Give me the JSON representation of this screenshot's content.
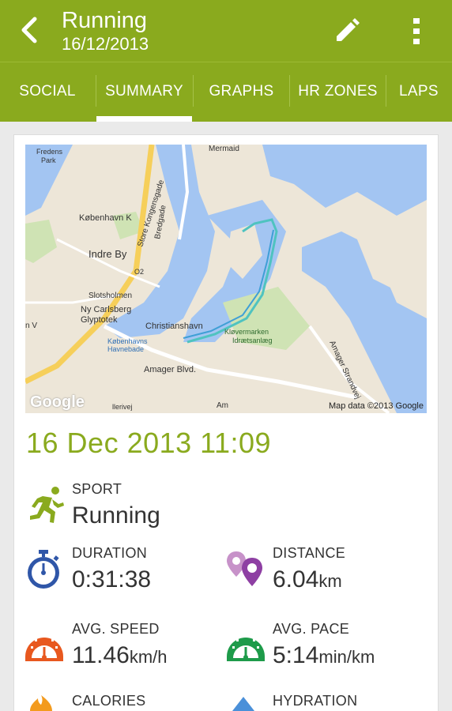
{
  "header": {
    "title": "Running",
    "subtitle": "16/12/2013"
  },
  "tabs": [
    {
      "label": "SOCIAL"
    },
    {
      "label": "SUMMARY"
    },
    {
      "label": "GRAPHS"
    },
    {
      "label": "HR ZONES"
    },
    {
      "label": "LAPS"
    }
  ],
  "active_tab": "SUMMARY",
  "map": {
    "provider": "Google",
    "credit": "Map data ©2013 Google",
    "labels": [
      "Mermaid",
      "Fredens Park",
      "København K",
      "Store Kongensgade",
      "Bredgade",
      "Indre By",
      "O2",
      "Slotsholmen",
      "Ny Carlsberg Glyptotek",
      "Christianshavn",
      "Københavns Havnebade",
      "Kløvermarken Idrætsanlæg",
      "Amager Blvd.",
      "Amager Strandvej",
      "llerivej",
      "n V",
      "Am"
    ]
  },
  "workout": {
    "datetime": "16 Dec 2013 11:09",
    "sport_label": "SPORT",
    "sport_value": "Running",
    "duration_label": "DURATION",
    "duration_value": "0:31:38",
    "distance_label": "DISTANCE",
    "distance_value": "6.04",
    "distance_unit": "km",
    "avg_speed_label": "AVG. SPEED",
    "avg_speed_value": "11.46",
    "avg_speed_unit": "km/h",
    "avg_pace_label": "AVG. PACE",
    "avg_pace_value": "5:14",
    "avg_pace_unit": "min/km",
    "calories_label": "CALORIES",
    "hydration_label": "HYDRATION"
  },
  "colors": {
    "brand_green": "#8aaa1e",
    "duration_blue": "#2f56a8",
    "distance_purple": "#8e3fa3",
    "speed_orange": "#e8581f",
    "pace_green": "#1e9b4a"
  }
}
